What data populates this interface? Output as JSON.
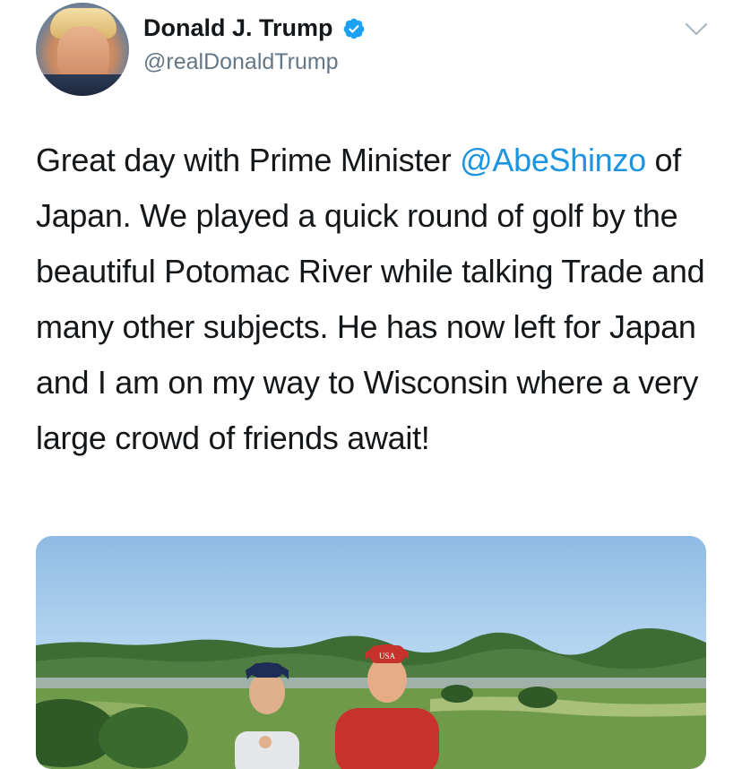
{
  "tweet": {
    "author_name": "Donald J. Trump",
    "author_handle": "@realDonaldTrump",
    "verified": true,
    "text_before": "Great day with Prime Minister ",
    "mention": "@AbeShinzo",
    "text_after": " of Japan. We played a quick round of golf by the beautiful Potomac River while talking Trade and many other subjects. He has now left for Japan and I am on my way to Wisconsin where a very large crowd of friends await!",
    "cap_text": "USA"
  },
  "icons": {
    "verified": "verified-badge-icon",
    "more": "chevron-down-icon"
  },
  "colors": {
    "mention": "#1b95e0",
    "verified": "#1da1f2",
    "secondary_text": "#657786"
  }
}
